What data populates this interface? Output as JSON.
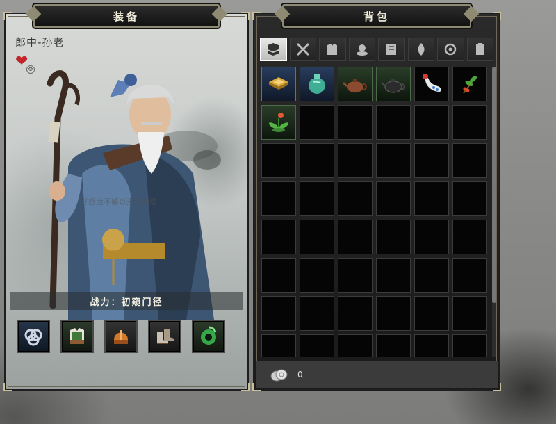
{
  "equipment": {
    "title": "装备",
    "character_name": "郎中-孙老",
    "hint": "好感度不够以无法切理",
    "power_label": "战力：初窥门径",
    "slots": [
      {
        "icon": "ring-icon",
        "quality": "blue"
      },
      {
        "icon": "armor-icon",
        "quality": "green"
      },
      {
        "icon": "helmet-icon",
        "quality": "normal"
      },
      {
        "icon": "boots-icon",
        "quality": "normal"
      },
      {
        "icon": "jade-pendant-icon",
        "quality": "green"
      }
    ]
  },
  "bag": {
    "title": "背包",
    "tabs": [
      {
        "icon": "all-items-icon",
        "active": true
      },
      {
        "icon": "weapon-icon",
        "active": false
      },
      {
        "icon": "armor-icon",
        "active": false
      },
      {
        "icon": "consumable-icon",
        "active": false
      },
      {
        "icon": "book-icon",
        "active": false
      },
      {
        "icon": "material-icon",
        "active": false
      },
      {
        "icon": "quest-icon",
        "active": false
      },
      {
        "icon": "misc-icon",
        "active": false
      }
    ],
    "items": [
      {
        "icon": "gold-tray-icon",
        "quality": "blue"
      },
      {
        "icon": "jade-vase-icon",
        "quality": "blue"
      },
      {
        "icon": "clay-teapot-icon",
        "quality": "green"
      },
      {
        "icon": "black-teapot-icon",
        "quality": "green"
      },
      {
        "icon": "porcelain-bottle-icon",
        "quality": "normal"
      },
      {
        "icon": "herb-sprig-icon",
        "quality": "normal"
      },
      {
        "icon": "flower-herb-icon",
        "quality": "green"
      }
    ],
    "total_cells": 48,
    "money": {
      "icon": "coin-stack-icon",
      "amount": "0"
    }
  }
}
